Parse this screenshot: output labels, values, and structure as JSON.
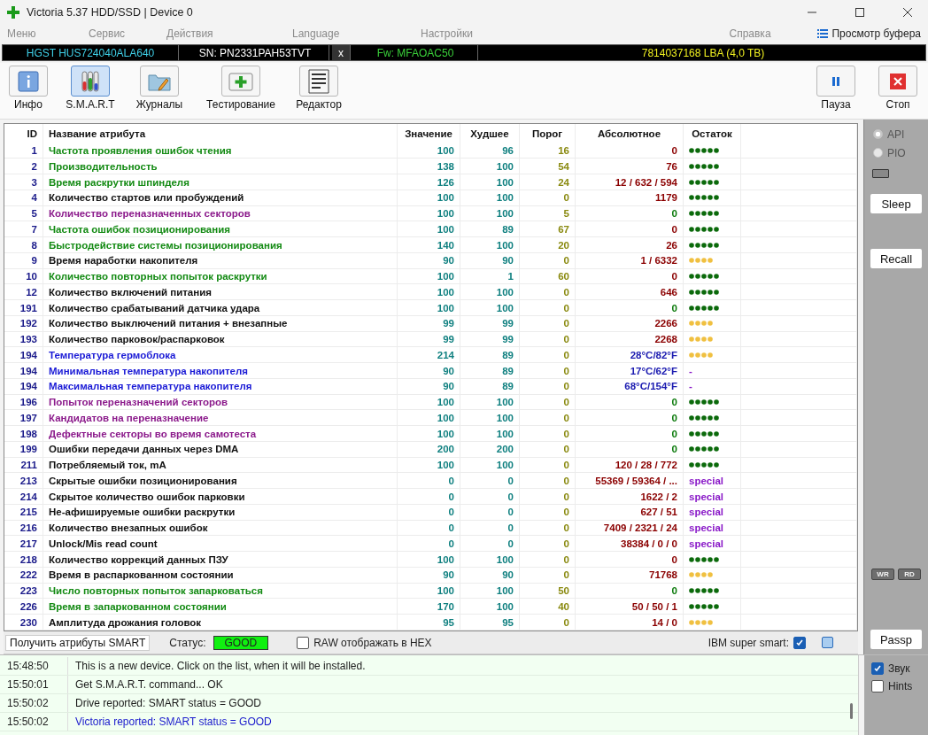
{
  "window": {
    "title": "Victoria 5.37 HDD/SSD | Device 0"
  },
  "menu": [
    "Меню",
    "Сервис",
    "Действия",
    "Language",
    "Настройки"
  ],
  "menu_right": {
    "help": "Справка",
    "buffer": "Просмотр буфера"
  },
  "drive": {
    "model": "HGST HUS724040ALA640",
    "serial": "SN: PN2331PAH53TVT",
    "close": "x",
    "firmware": "Fw: MFAOAC50",
    "capacity": "7814037168 LBA (4,0 TB)"
  },
  "toolbar": [
    {
      "kind": "info",
      "label": "Инфо",
      "selected": false
    },
    {
      "kind": "smart",
      "label": "S.M.A.R.T",
      "selected": true
    },
    {
      "kind": "logs",
      "label": "Журналы",
      "selected": false
    },
    {
      "kind": "test",
      "label": "Тестирование",
      "selected": false
    },
    {
      "kind": "editor",
      "label": "Редактор",
      "selected": false
    }
  ],
  "toolbar_right": [
    {
      "kind": "pause",
      "label": "Пауза"
    },
    {
      "kind": "stop",
      "label": "Стоп"
    }
  ],
  "table": {
    "columns": [
      "ID",
      "Название атрибута",
      "Значение",
      "Худшее",
      "Порог",
      "Абсолютное",
      "Остаток"
    ],
    "rows": [
      {
        "id": "1",
        "name": "Частота проявления ошибок чтения",
        "color": "#138a13",
        "value": "100",
        "worst": "96",
        "threshold": "16",
        "raw": {
          "text": "0",
          "color": "#8b0000"
        },
        "rest": {
          "kind": "good"
        }
      },
      {
        "id": "2",
        "name": "Производительность",
        "color": "#138a13",
        "value": "138",
        "worst": "100",
        "threshold": "54",
        "raw": {
          "text": "76",
          "color": "#8b0000"
        },
        "rest": {
          "kind": "good"
        }
      },
      {
        "id": "3",
        "name": "Время раскрутки шпинделя",
        "color": "#138a13",
        "value": "126",
        "worst": "100",
        "threshold": "24",
        "raw": {
          "text": "12 / 632 / 594",
          "color": "#8b0000"
        },
        "rest": {
          "kind": "good"
        }
      },
      {
        "id": "4",
        "name": "Количество стартов или пробуждений",
        "color": "#111111",
        "value": "100",
        "worst": "100",
        "threshold": "0",
        "raw": {
          "text": "1179",
          "color": "#8b0000"
        },
        "rest": {
          "kind": "good"
        }
      },
      {
        "id": "5",
        "name": "Количество переназначенных секторов",
        "color": "#8b1a8b",
        "value": "100",
        "worst": "100",
        "threshold": "5",
        "raw": {
          "text": "0",
          "color": "#0b7a0b"
        },
        "rest": {
          "kind": "good"
        }
      },
      {
        "id": "7",
        "name": "Частота ошибок позиционирования",
        "color": "#138a13",
        "value": "100",
        "worst": "89",
        "threshold": "67",
        "raw": {
          "text": "0",
          "color": "#8b0000"
        },
        "rest": {
          "kind": "good"
        }
      },
      {
        "id": "8",
        "name": "Быстродействие системы позиционирования",
        "color": "#138a13",
        "value": "140",
        "worst": "100",
        "threshold": "20",
        "raw": {
          "text": "26",
          "color": "#8b0000"
        },
        "rest": {
          "kind": "good"
        }
      },
      {
        "id": "9",
        "name": "Время наработки накопителя",
        "color": "#111111",
        "value": "90",
        "worst": "90",
        "threshold": "0",
        "raw": {
          "text": "1 / 6332",
          "color": "#8b0000"
        },
        "rest": {
          "kind": "warn"
        }
      },
      {
        "id": "10",
        "name": "Количество повторных попыток раскрутки",
        "color": "#138a13",
        "value": "100",
        "worst": "1",
        "threshold": "60",
        "raw": {
          "text": "0",
          "color": "#8b0000"
        },
        "rest": {
          "kind": "good"
        }
      },
      {
        "id": "12",
        "name": "Количество включений питания",
        "color": "#111111",
        "value": "100",
        "worst": "100",
        "threshold": "0",
        "raw": {
          "text": "646",
          "color": "#8b0000"
        },
        "rest": {
          "kind": "good"
        }
      },
      {
        "id": "191",
        "name": "Количество срабатываний датчика удара",
        "color": "#111111",
        "value": "100",
        "worst": "100",
        "threshold": "0",
        "raw": {
          "text": "0",
          "color": "#0b7a0b"
        },
        "rest": {
          "kind": "good"
        }
      },
      {
        "id": "192",
        "name": "Количество выключений питания + внезапные",
        "color": "#111111",
        "value": "99",
        "worst": "99",
        "threshold": "0",
        "raw": {
          "text": "2266",
          "color": "#8b0000"
        },
        "rest": {
          "kind": "warn"
        }
      },
      {
        "id": "193",
        "name": "Количество парковок/распарковок",
        "color": "#111111",
        "value": "99",
        "worst": "99",
        "threshold": "0",
        "raw": {
          "text": "2268",
          "color": "#8b0000"
        },
        "rest": {
          "kind": "warn"
        }
      },
      {
        "id": "194",
        "name": "Температура гермоблока",
        "color": "#1a1ad6",
        "value": "214",
        "worst": "89",
        "threshold": "0",
        "raw": {
          "text": "28°C/82°F",
          "color": "#1a1ab0"
        },
        "rest": {
          "kind": "warn"
        }
      },
      {
        "id": "194",
        "name": "Минимальная температура накопителя",
        "color": "#1a1ad6",
        "value": "90",
        "worst": "89",
        "threshold": "0",
        "raw": {
          "text": "17°C/62°F",
          "color": "#1a1ab0"
        },
        "rest": {
          "kind": "text",
          "text": "-"
        }
      },
      {
        "id": "194",
        "name": "Максимальная температура накопителя",
        "color": "#1a1ad6",
        "value": "90",
        "worst": "89",
        "threshold": "0",
        "raw": {
          "text": "68°C/154°F",
          "color": "#1a1ab0"
        },
        "rest": {
          "kind": "text",
          "text": "-"
        }
      },
      {
        "id": "196",
        "name": "Попыток переназначений секторов",
        "color": "#8b1a8b",
        "value": "100",
        "worst": "100",
        "threshold": "0",
        "raw": {
          "text": "0",
          "color": "#0b7a0b"
        },
        "rest": {
          "kind": "good"
        }
      },
      {
        "id": "197",
        "name": "Кандидатов на переназначение",
        "color": "#8b1a8b",
        "value": "100",
        "worst": "100",
        "threshold": "0",
        "raw": {
          "text": "0",
          "color": "#0b7a0b"
        },
        "rest": {
          "kind": "good"
        }
      },
      {
        "id": "198",
        "name": "Дефектные секторы во время самотеста",
        "color": "#8b1a8b",
        "value": "100",
        "worst": "100",
        "threshold": "0",
        "raw": {
          "text": "0",
          "color": "#0b7a0b"
        },
        "rest": {
          "kind": "good"
        }
      },
      {
        "id": "199",
        "name": "Ошибки передачи данных через DMA",
        "color": "#111111",
        "value": "200",
        "worst": "200",
        "threshold": "0",
        "raw": {
          "text": "0",
          "color": "#0b7a0b"
        },
        "rest": {
          "kind": "good"
        }
      },
      {
        "id": "211",
        "name": "Потребляемый ток, mA",
        "color": "#111111",
        "value": "100",
        "worst": "100",
        "threshold": "0",
        "raw": {
          "text": "120 / 28 / 772",
          "color": "#8b0000"
        },
        "rest": {
          "kind": "good"
        }
      },
      {
        "id": "213",
        "name": "Скрытые ошибки позиционирования",
        "color": "#111111",
        "value": "0",
        "worst": "0",
        "threshold": "0",
        "raw": {
          "text": "55369 / 59364 / ...",
          "color": "#8b0000"
        },
        "rest": {
          "kind": "text",
          "text": "special"
        }
      },
      {
        "id": "214",
        "name": "Скрытое количество ошибок парковки",
        "color": "#111111",
        "value": "0",
        "worst": "0",
        "threshold": "0",
        "raw": {
          "text": "1622 / 2",
          "color": "#8b0000"
        },
        "rest": {
          "kind": "text",
          "text": "special"
        }
      },
      {
        "id": "215",
        "name": "Не-афишируемые ошибки раскрутки",
        "color": "#111111",
        "value": "0",
        "worst": "0",
        "threshold": "0",
        "raw": {
          "text": "627 / 51",
          "color": "#8b0000"
        },
        "rest": {
          "kind": "text",
          "text": "special"
        }
      },
      {
        "id": "216",
        "name": "Количество внезапных ошибок",
        "color": "#111111",
        "value": "0",
        "worst": "0",
        "threshold": "0",
        "raw": {
          "text": "7409 / 2321 / 24",
          "color": "#8b0000"
        },
        "rest": {
          "kind": "text",
          "text": "special"
        }
      },
      {
        "id": "217",
        "name": "Unlock/Mis read count",
        "color": "#111111",
        "value": "0",
        "worst": "0",
        "threshold": "0",
        "raw": {
          "text": "38384 / 0 / 0",
          "color": "#8b0000"
        },
        "rest": {
          "kind": "text",
          "text": "special"
        }
      },
      {
        "id": "218",
        "name": "Количество коррекций данных ПЗУ",
        "color": "#111111",
        "value": "100",
        "worst": "100",
        "threshold": "0",
        "raw": {
          "text": "0",
          "color": "#8b0000"
        },
        "rest": {
          "kind": "good"
        }
      },
      {
        "id": "222",
        "name": "Время в распаркованном состоянии",
        "color": "#111111",
        "value": "90",
        "worst": "90",
        "threshold": "0",
        "raw": {
          "text": "71768",
          "color": "#8b0000"
        },
        "rest": {
          "kind": "warn"
        }
      },
      {
        "id": "223",
        "name": "Число повторных попыток запарковаться",
        "color": "#138a13",
        "value": "100",
        "worst": "100",
        "threshold": "50",
        "raw": {
          "text": "0",
          "color": "#0b7a0b"
        },
        "rest": {
          "kind": "good"
        }
      },
      {
        "id": "226",
        "name": "Время в запаркованном состоянии",
        "color": "#138a13",
        "value": "170",
        "worst": "100",
        "threshold": "40",
        "raw": {
          "text": "50 / 50 / 1",
          "color": "#8b0000"
        },
        "rest": {
          "kind": "good"
        }
      },
      {
        "id": "230",
        "name": "Амплитуда дрожания головок",
        "color": "#111111",
        "value": "95",
        "worst": "95",
        "threshold": "0",
        "raw": {
          "text": "14 / 0",
          "color": "#8b0000"
        },
        "rest": {
          "kind": "warn"
        }
      }
    ]
  },
  "smart_bar": {
    "button": "Получить атрибуты SMART",
    "status_label": "Статус:",
    "status": "GOOD",
    "raw_hex": {
      "label": "RAW отображать в HEX",
      "checked": false
    },
    "ibm": {
      "label": "IBM super smart:",
      "checked": true
    },
    "extra_checked": false
  },
  "side": {
    "modes": [
      {
        "label": "API",
        "selected": true
      },
      {
        "label": "PIO",
        "selected": false
      }
    ],
    "buttons": [
      "Sleep",
      "Recall"
    ],
    "indicators": [
      "WR",
      "RD"
    ],
    "passp": "Passp"
  },
  "log": [
    {
      "time": "15:48:50",
      "text": "This is a new device. Click on the list, when it will be installed.",
      "color": "#1a1a1a"
    },
    {
      "time": "15:50:01",
      "text": "Get S.M.A.R.T. command... OK",
      "color": "#1a1a1a"
    },
    {
      "time": "15:50:02",
      "text": "Drive reported: SMART status = GOOD",
      "color": "#1a1a1a"
    },
    {
      "time": "15:50:02",
      "text": "Victoria reported: SMART status = GOOD",
      "color": "#1a1acc"
    }
  ],
  "log_options": [
    {
      "label": "Звук",
      "checked": true
    },
    {
      "label": "Hints",
      "checked": false
    }
  ]
}
